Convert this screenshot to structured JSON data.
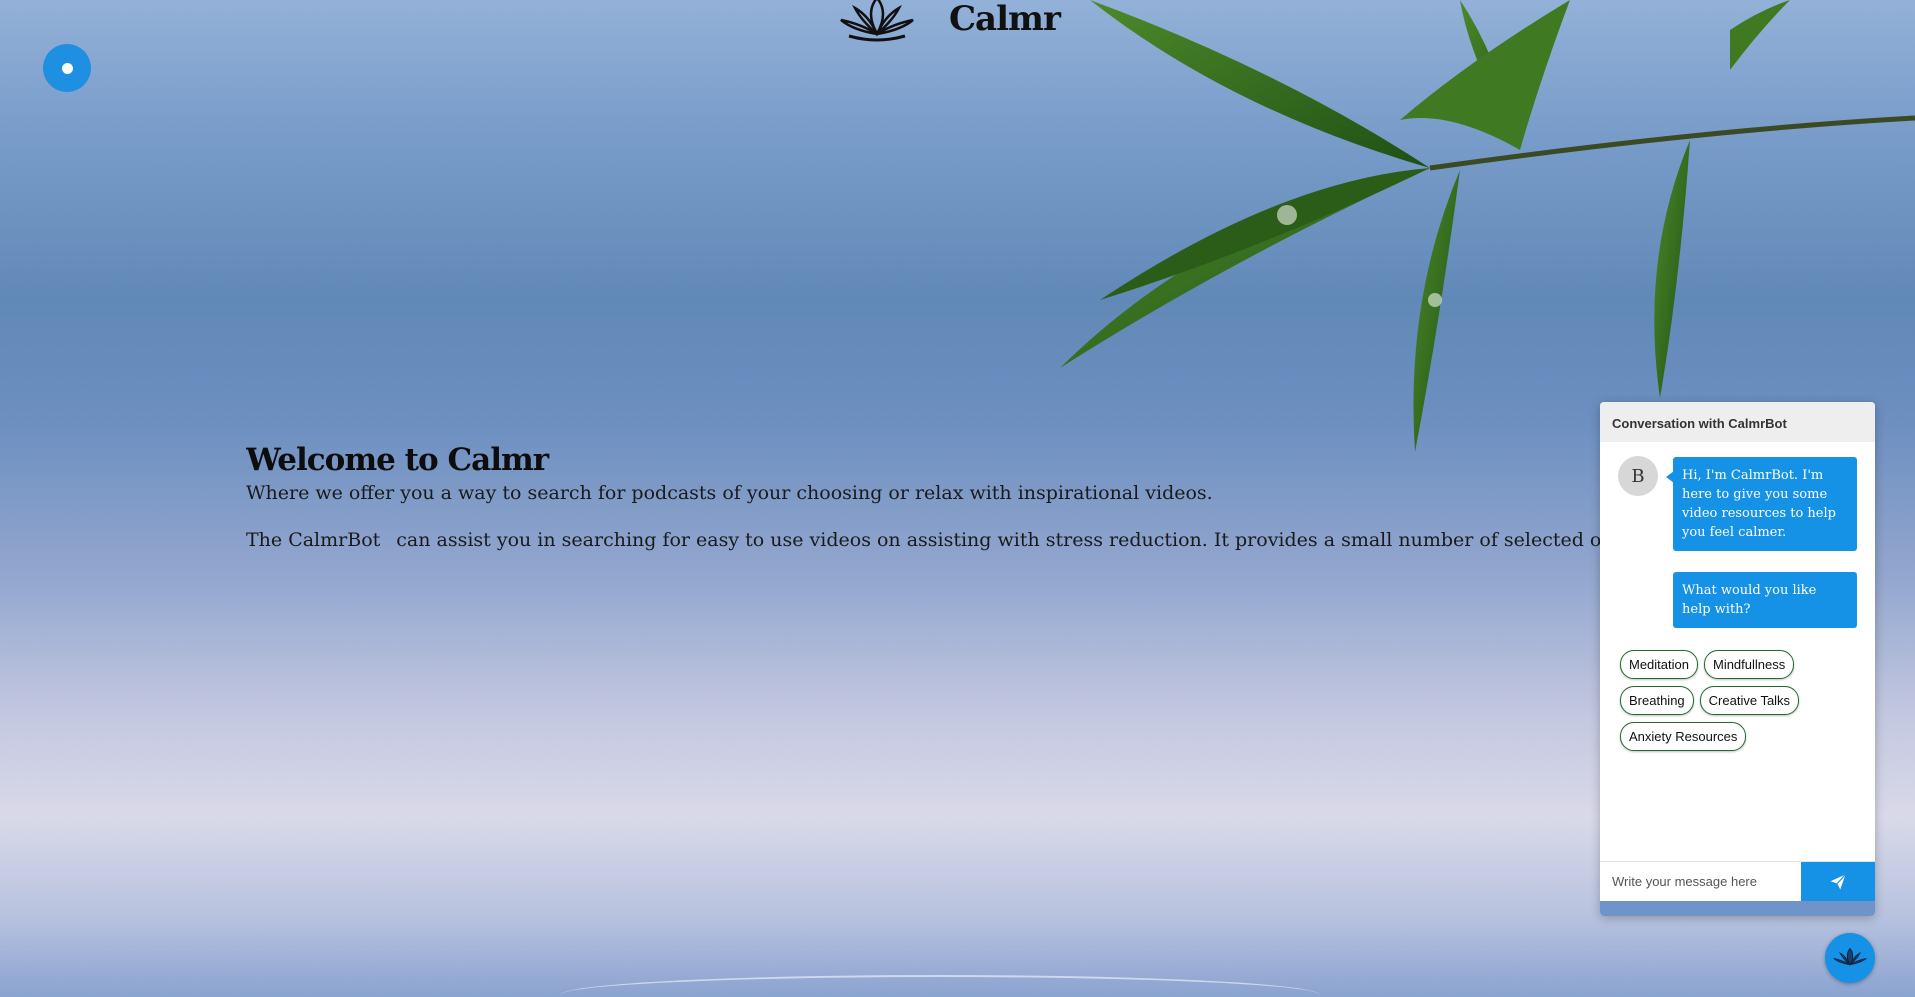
{
  "header": {
    "brand": "Calmr"
  },
  "intro": {
    "heading": "Welcome to Calmr",
    "tagline": "Where we offer you a way to search for podcasts of your choosing or relax with inspirational videos.",
    "bot_text_before": "The CalmrBot",
    "bot_text_after": "can assist you in searching for easy to use videos on assisting with stress reduction. It provides a small number of selected options f"
  },
  "chat": {
    "title": "Conversation with CalmrBot",
    "avatar_letter": "B",
    "messages": [
      "Hi, I'm CalmrBot. I'm here to give you some video resources to help you feel calmer.",
      "What would you like help with?"
    ],
    "options": [
      "Meditation",
      "Mindfullness",
      "Breathing",
      "Creative Talks",
      "Anxiety Resources"
    ],
    "input_placeholder": "Write your message here"
  },
  "colors": {
    "accent": "#1591e5",
    "option_border": "#1f6b2f",
    "leaf": "#2f6a1c"
  },
  "icons": {
    "menu": "dot-icon",
    "logo": "lotus-icon",
    "send": "paper-plane-icon",
    "launcher": "lotus-icon"
  }
}
